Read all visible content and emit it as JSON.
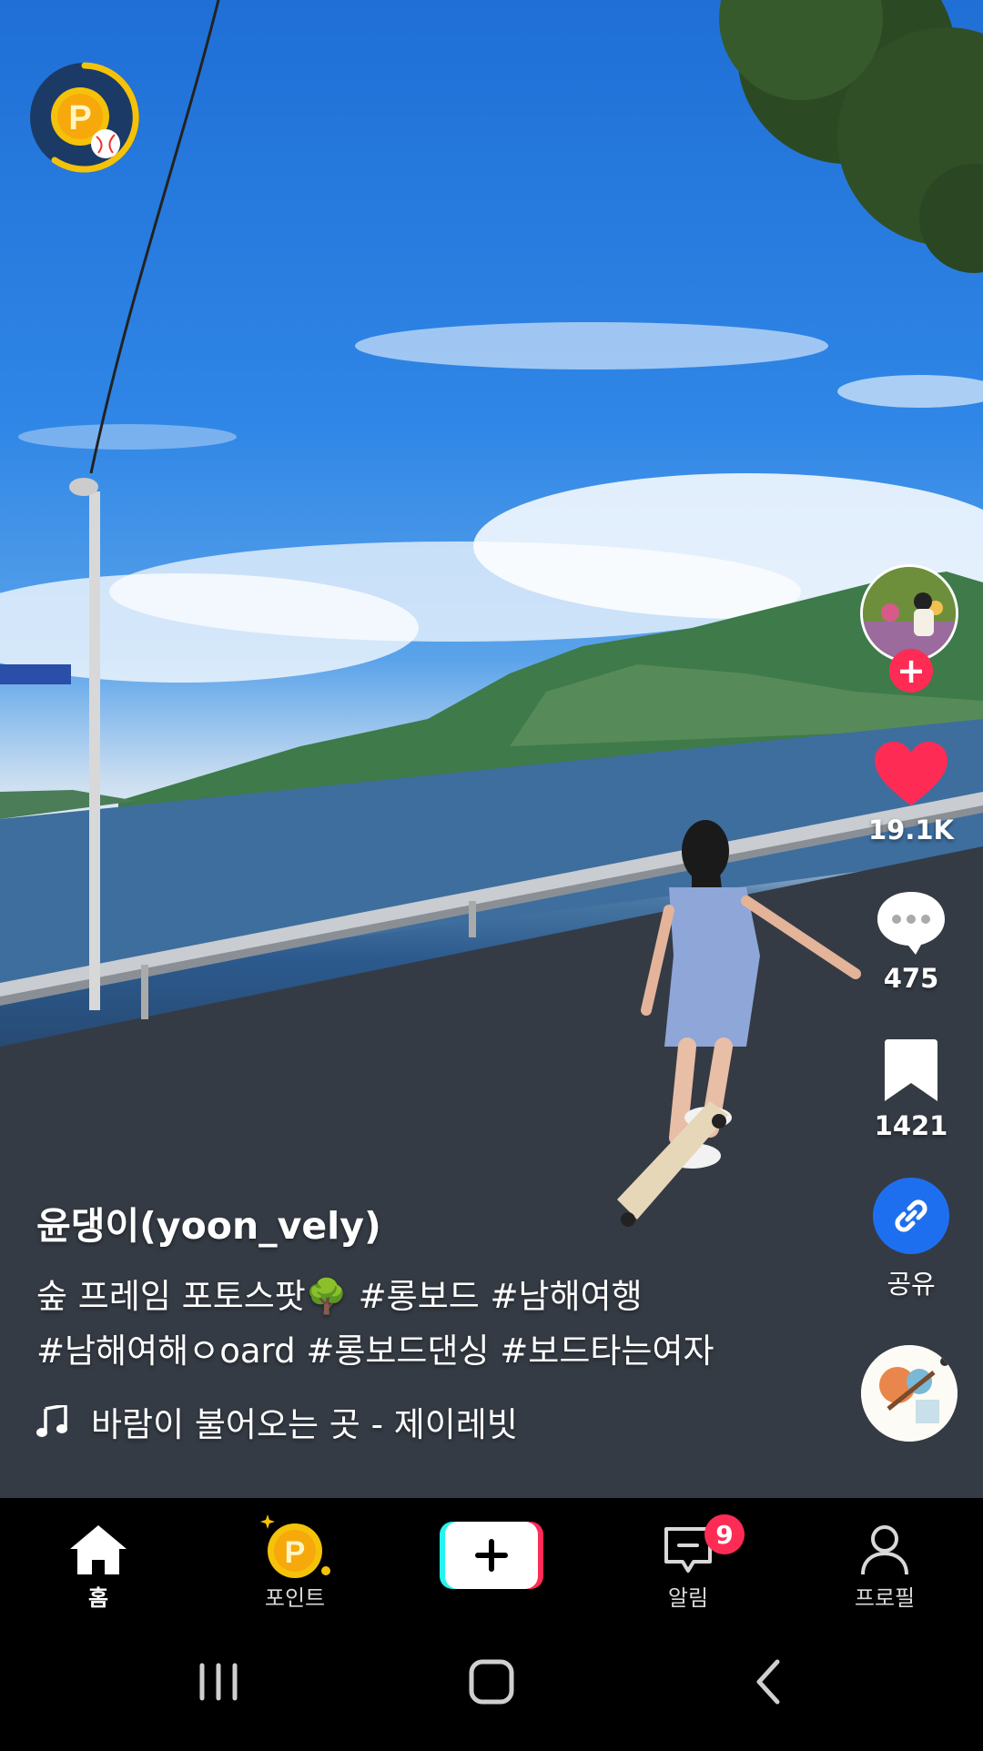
{
  "author": {
    "name": "윤댕이(yoon_vely)"
  },
  "caption": {
    "line1": "숲 프레임 포토스팟🌳 #롱보드 #남해여행",
    "line2": "#남해여해ㅇoard #롱보드댄싱 #보드타는여자"
  },
  "music": {
    "icon": "music-note-icon",
    "title": "바람이 불어오는 곳 - 제이레빗"
  },
  "rail": {
    "likes": "19.1K",
    "comments": "475",
    "bookmarks": "1421",
    "share_label": "공유"
  },
  "nav": {
    "home": "홈",
    "points": "포인트",
    "notifications": "알림",
    "notifications_badge": "9",
    "profile": "프로필"
  },
  "colors": {
    "accent_red": "#fe2c55",
    "share_blue": "#1e6ff0",
    "point_gold": "#f5c20a",
    "create_cyan": "#25f4ee"
  }
}
